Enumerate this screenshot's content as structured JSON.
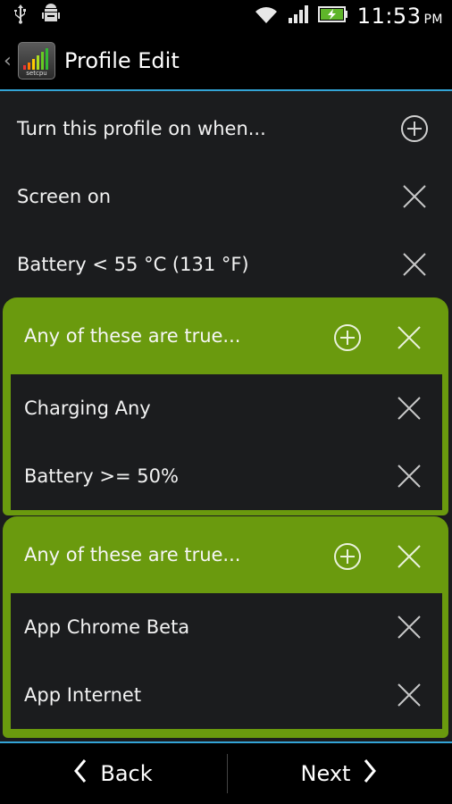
{
  "status_bar": {
    "left_icons": [
      "usb-icon",
      "android-debug-icon"
    ],
    "right_icons": [
      "wifi-icon",
      "signal-icon",
      "battery-charging-icon"
    ],
    "time": "11:53",
    "ampm": "PM"
  },
  "action_bar": {
    "up_glyph": "‹",
    "app_icon_label": "setcpu",
    "title": "Profile Edit"
  },
  "rows": [
    {
      "label": "Turn this profile on when...",
      "action": "add"
    },
    {
      "label": "Screen on",
      "action": "remove"
    },
    {
      "label": "Battery < 55 °C (131 °F)",
      "action": "remove"
    }
  ],
  "groups": [
    {
      "header": "Any of these are true...",
      "items": [
        "Charging Any",
        "Battery >= 50%"
      ]
    },
    {
      "header": "Any of these are true...",
      "items": [
        "App Chrome Beta",
        "App Internet"
      ]
    }
  ],
  "bottom_bar": {
    "back_label": "Back",
    "next_label": "Next"
  },
  "colors": {
    "accent": "#33a4d6",
    "group_green": "#6a9a0e",
    "content_bg": "#1b1c1e"
  }
}
